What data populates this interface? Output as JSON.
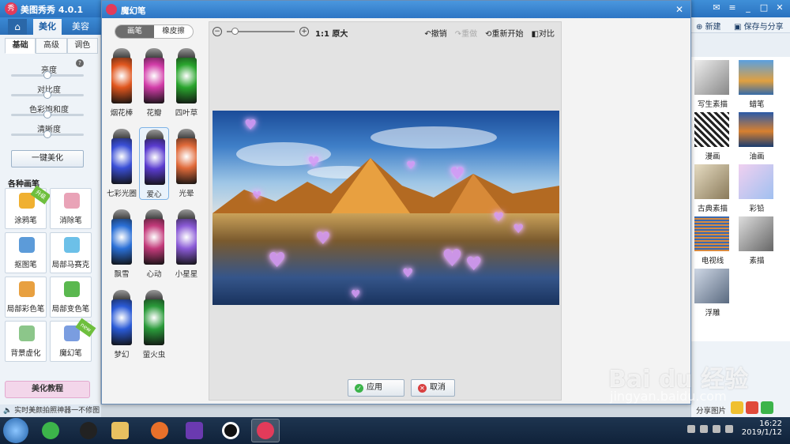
{
  "app": {
    "title": "美图秀秀 4.0.1",
    "tabs": [
      "美化",
      "美容"
    ],
    "sub_tabs": [
      "基础",
      "高级",
      "调色"
    ],
    "sliders": [
      {
        "label": "亮度",
        "value": 0.5
      },
      {
        "label": "对比度",
        "value": 0.5
      },
      {
        "label": "色彩饱和度",
        "value": 0.5
      },
      {
        "label": "清晰度",
        "value": 0.5
      }
    ],
    "one_key_label": "一键美化",
    "brush_header": "各种画笔",
    "brushes": [
      {
        "label": "涂鸦笔",
        "badge": "升级"
      },
      {
        "label": "消除笔",
        "badge": ""
      },
      {
        "label": "抠图笔",
        "badge": ""
      },
      {
        "label": "局部马赛克",
        "badge": ""
      },
      {
        "label": "局部彩色笔",
        "badge": ""
      },
      {
        "label": "局部变色笔",
        "badge": ""
      },
      {
        "label": "背景虚化",
        "badge": ""
      },
      {
        "label": "魔幻笔",
        "badge": "new"
      }
    ],
    "tutorial_label": "美化教程",
    "status_text": "实时美颜拍照神器一不修图",
    "right_toolbar": {
      "new_label": "新建",
      "save_label": "保存与分享"
    },
    "effects": [
      "写生素描",
      "蜡笔",
      "漫画",
      "油画",
      "古典素描",
      "彩铅",
      "电视线",
      "素描",
      "浮雕"
    ],
    "share_label": "分享图片",
    "colors": {
      "accent": "#2e76c4",
      "brand": "#e23b5a"
    }
  },
  "dialog": {
    "title": "魔幻笔",
    "pen_tabs": [
      "画笔",
      "橡皮擦"
    ],
    "pens": [
      {
        "label": "烟花棒",
        "color": "#e0561e"
      },
      {
        "label": "花瓣",
        "color": "#d23ca8"
      },
      {
        "label": "四叶草",
        "color": "#2aa52e"
      },
      {
        "label": "七彩光圈",
        "color": "#3a4fd6"
      },
      {
        "label": "爱心",
        "color": "#5a3ccf"
      },
      {
        "label": "光晕",
        "color": "#e06a3a"
      },
      {
        "label": "飘雪",
        "color": "#2a6fd6"
      },
      {
        "label": "心动",
        "color": "#c23a7a"
      },
      {
        "label": "小星星",
        "color": "#8a5ad6"
      },
      {
        "label": "梦幻",
        "color": "#2a5ad6"
      },
      {
        "label": "萤火虫",
        "color": "#2a9a3a"
      }
    ],
    "selected_pen": "爱心",
    "zoom_ratio": "1:1",
    "zoom_label": "原大",
    "tools": {
      "undo": "撤销",
      "redo": "重做",
      "restart": "重新开始",
      "compare": "对比"
    },
    "apply_label": "应用",
    "cancel_label": "取消"
  },
  "taskbar": {
    "time": "16:22",
    "date": "2019/1/12"
  },
  "watermark": {
    "brand": "Bai du 经验",
    "url": "jingyan.baidu.com"
  }
}
